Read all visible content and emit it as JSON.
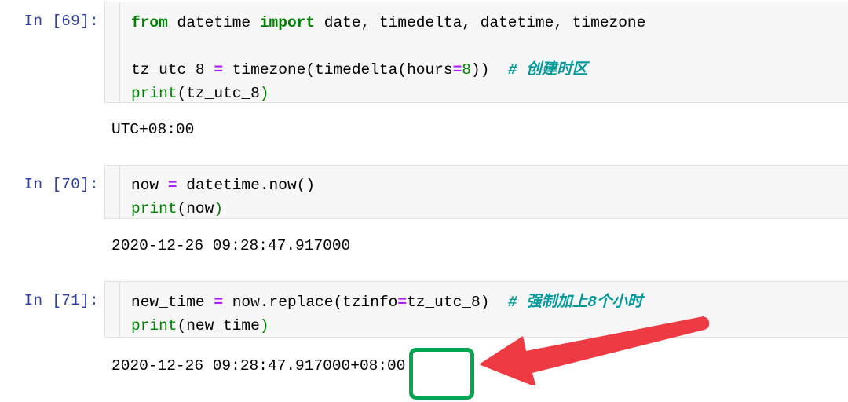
{
  "notebook": {
    "cells": [
      {
        "prompt": "In [69]:",
        "code_lines": [
          {
            "tokens": [
              {
                "t": "from",
                "c": "kw"
              },
              {
                "t": " datetime ",
                "c": ""
              },
              {
                "t": "import",
                "c": "kw"
              },
              {
                "t": " date, timedelta, datetime, timezone",
                "c": ""
              }
            ]
          },
          {
            "tokens": []
          },
          {
            "tokens": [
              {
                "t": "tz_utc_8 ",
                "c": ""
              },
              {
                "t": "=",
                "c": "op"
              },
              {
                "t": " timezone(timedelta(hours",
                "c": ""
              },
              {
                "t": "=",
                "c": "op"
              },
              {
                "t": "8",
                "c": "num"
              },
              {
                "t": "))  ",
                "c": ""
              },
              {
                "t": "# 创建时区",
                "c": "cmt"
              }
            ]
          },
          {
            "tokens": [
              {
                "t": "print",
                "c": "fn"
              },
              {
                "t": "(tz_utc_8",
                "c": ""
              },
              {
                "t": ")",
                "c": "fn"
              }
            ]
          }
        ],
        "output": "UTC+08:00"
      },
      {
        "prompt": "In [70]:",
        "code_lines": [
          {
            "tokens": [
              {
                "t": "now ",
                "c": ""
              },
              {
                "t": "=",
                "c": "op"
              },
              {
                "t": " datetime.now()",
                "c": ""
              }
            ]
          },
          {
            "tokens": [
              {
                "t": "print",
                "c": "fn"
              },
              {
                "t": "(now",
                "c": ""
              },
              {
                "t": ")",
                "c": "fn"
              }
            ]
          }
        ],
        "output": "2020-12-26 09:28:47.917000"
      },
      {
        "prompt": "In [71]:",
        "code_lines": [
          {
            "tokens": [
              {
                "t": "new_time ",
                "c": ""
              },
              {
                "t": "=",
                "c": "op"
              },
              {
                "t": " now.replace(tzinfo",
                "c": ""
              },
              {
                "t": "=",
                "c": "op"
              },
              {
                "t": "tz_utc_8)  ",
                "c": ""
              },
              {
                "t": "# 强制加上8个小时",
                "c": "cmt"
              }
            ]
          },
          {
            "tokens": [
              {
                "t": "print",
                "c": "fn"
              },
              {
                "t": "(new_time",
                "c": ""
              },
              {
                "t": ")",
                "c": "fn"
              }
            ]
          }
        ],
        "output": "2020-12-26 09:28:47.917000+08:00"
      }
    ]
  },
  "annotations": {
    "highlight": {
      "label": "08:00",
      "color": "#00A651"
    },
    "arrow": {
      "label": "points-at-timezone-offset",
      "color": "#EE3A43"
    }
  },
  "colors": {
    "prompt": "#303F9F",
    "keyword": "#008000",
    "operator": "#AA22FF",
    "number": "#008000",
    "comment": "#009999",
    "cell_background": "#f7f7f7",
    "highlight_green": "#00A651",
    "arrow_red": "#EE3A43"
  }
}
